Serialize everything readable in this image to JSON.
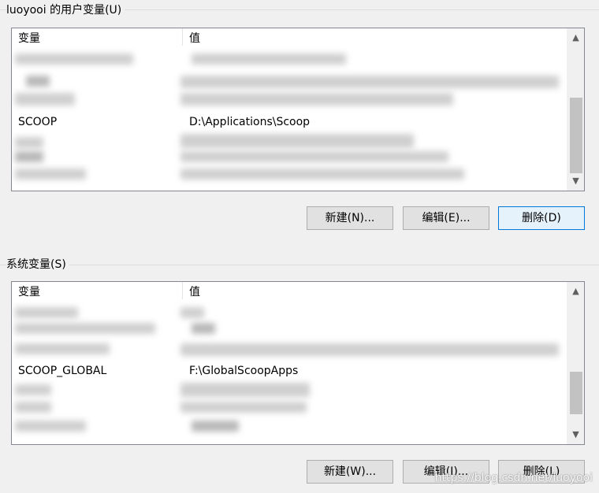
{
  "user_vars": {
    "title": "luoyooi 的用户变量(U)",
    "header_variable": "变量",
    "header_value": "值",
    "visible_row": {
      "name": "SCOOP",
      "value": "D:\\Applications\\Scoop"
    },
    "buttons": {
      "new": "新建(N)...",
      "edit": "编辑(E)...",
      "delete": "删除(D)"
    }
  },
  "system_vars": {
    "title": "系统变量(S)",
    "header_variable": "变量",
    "header_value": "值",
    "visible_row": {
      "name": "SCOOP_GLOBAL",
      "value": "F:\\GlobalScoopApps"
    },
    "buttons": {
      "new": "新建(W)...",
      "edit": "编辑(I)...",
      "delete": "删除(L)"
    }
  },
  "scroll": {
    "up_icon": "▲",
    "down_icon": "▼"
  },
  "watermark": "https://blog.csdn.net/luoyooi",
  "colors": {
    "default_button_border": "#0078d7",
    "default_button_bg": "#e5f1fb",
    "window_bg": "#f0f0f0"
  }
}
